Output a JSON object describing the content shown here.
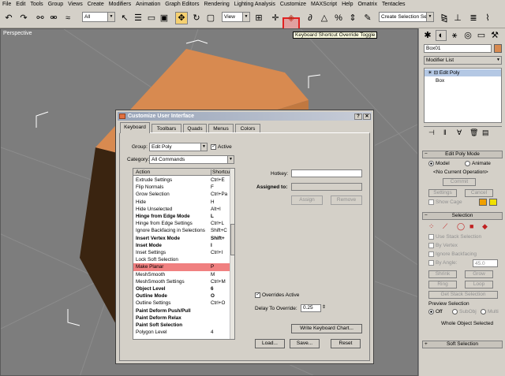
{
  "menu": [
    "File",
    "Edit",
    "Tools",
    "Group",
    "Views",
    "Create",
    "Modifiers",
    "Animation",
    "Graph Editors",
    "Rendering",
    "Lighting Analysis",
    "Customize",
    "MAXScript",
    "Help",
    "Omatrix",
    "Tentacles"
  ],
  "toolbar": {
    "filter_select": "All",
    "refcoord_select": "View",
    "named_selection": "Create Selection Set",
    "tooltip": "Keyboard Shortcut Override Toggle"
  },
  "viewport": {
    "label": "Perspective"
  },
  "right_panel": {
    "object_name": "Box01",
    "modifier_list": "Modifier List",
    "stack": [
      "Edit Poly",
      "Box"
    ],
    "edit_poly_mode": {
      "title": "Edit Poly Mode",
      "model": "Model",
      "animate": "Animate",
      "current_op": "<No Current Operation>",
      "commit": "Commit",
      "settings": "Settings",
      "cancel": "Cancel",
      "show_cage": "Show Cage"
    },
    "selection": {
      "title": "Selection",
      "use_stack": "Use Stack Selection",
      "by_vertex": "By Vertex",
      "ignore_backfacing": "Ignore Backfacing",
      "by_angle": "By Angle:",
      "angle_value": "45.0",
      "shrink": "Shrink",
      "grow": "Grow",
      "ring": "Ring",
      "loop": "Loop",
      "get_stack": "Get Stack Selection",
      "preview_title": "Preview Selection",
      "off": "Off",
      "subobj": "SubObj",
      "multi": "Multi",
      "status": "Whole Object Selected"
    },
    "soft_selection": "Soft Selection"
  },
  "dialog": {
    "title": "Customize User Interface",
    "tabs": [
      "Keyboard",
      "Toolbars",
      "Quads",
      "Menus",
      "Colors"
    ],
    "group_label": "Group:",
    "group_value": "Edit Poly",
    "active_label": "Active",
    "category_label": "Category:",
    "category_value": "All Commands",
    "col_action": "Action",
    "col_shortcut": "Shortcut",
    "rows": [
      {
        "a": "Extrude Settings",
        "s": "Ctrl+E",
        "b": false
      },
      {
        "a": "Flip Normals",
        "s": "F",
        "b": false
      },
      {
        "a": "Grow Selection",
        "s": "Ctrl+Pa",
        "b": false
      },
      {
        "a": "Hide",
        "s": "H",
        "b": false
      },
      {
        "a": "Hide Unselected",
        "s": "Alt+I",
        "b": false
      },
      {
        "a": "Hinge from Edge Mode",
        "s": "L",
        "b": true
      },
      {
        "a": "Hinge from Edge Settings",
        "s": "Ctrl+L",
        "b": false
      },
      {
        "a": "Ignore Backfacing in Selections",
        "s": "Shift+C",
        "b": false
      },
      {
        "a": "Insert Vertex Mode",
        "s": "Shift+",
        "b": true
      },
      {
        "a": "Inset Mode",
        "s": "I",
        "b": true
      },
      {
        "a": "Inset Settings",
        "s": "Ctrl+I",
        "b": false
      },
      {
        "a": "Lock Soft Selection",
        "s": "",
        "b": false
      },
      {
        "a": "Make Planar",
        "s": "P",
        "b": false,
        "sel": true
      },
      {
        "a": "MeshSmooth",
        "s": "M",
        "b": false
      },
      {
        "a": "MeshSmooth Settings",
        "s": "Ctrl+M",
        "b": false
      },
      {
        "a": "Object Level",
        "s": "6",
        "b": true
      },
      {
        "a": "Outline Mode",
        "s": "O",
        "b": true
      },
      {
        "a": "Outline Settings",
        "s": "Ctrl+O",
        "b": false
      },
      {
        "a": "Paint Deform Push/Pull",
        "s": "",
        "b": true
      },
      {
        "a": "Paint Deform Relax",
        "s": "",
        "b": true
      },
      {
        "a": "Paint Soft Selection",
        "s": "",
        "b": true
      },
      {
        "a": "Polygon Level",
        "s": "4",
        "b": false
      }
    ],
    "hotkey_label": "Hotkey:",
    "assigned_label": "Assigned to:",
    "assign": "Assign",
    "remove": "Remove",
    "overrides_active": "Overrides Active",
    "delay_label": "Delay To Override:",
    "delay_value": "0.25",
    "write_chart": "Write Keyboard Chart...",
    "load": "Load...",
    "save": "Save...",
    "reset": "Reset"
  },
  "colors": {
    "box_top": "#d88a50",
    "box_side": "#3a2410",
    "viewport_bg": "#7d7d7d",
    "selected_row": "#f08080",
    "highlight": "#e02020"
  }
}
